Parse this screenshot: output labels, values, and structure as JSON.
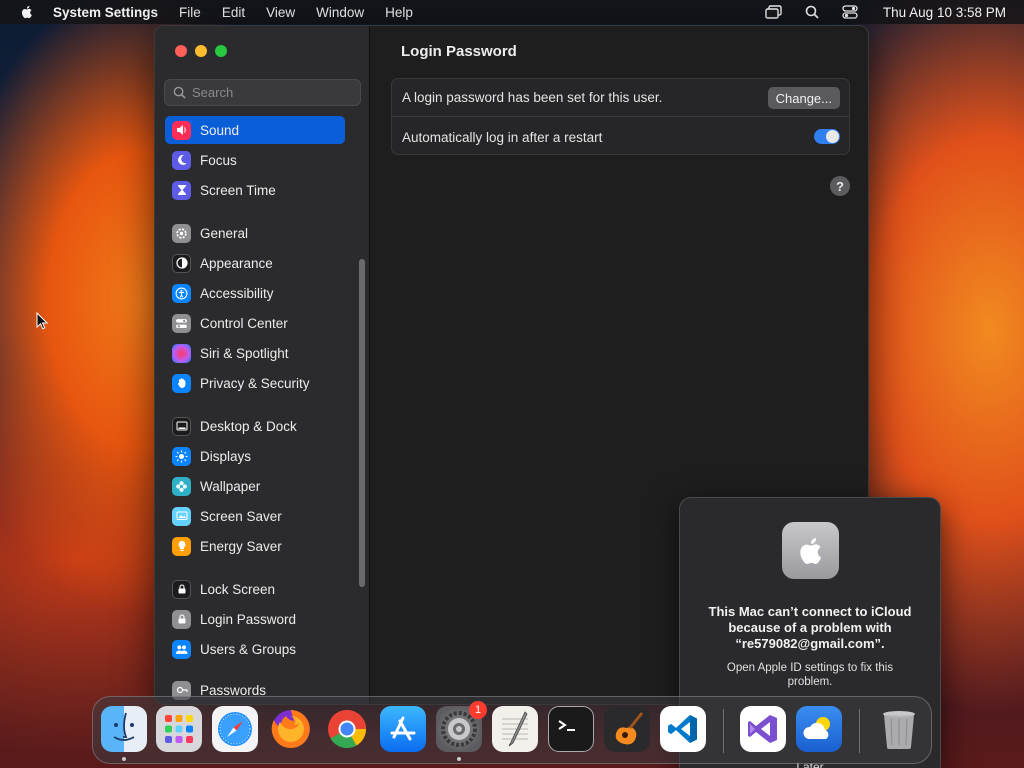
{
  "menubar": {
    "app_name": "System Settings",
    "items": [
      "File",
      "Edit",
      "View",
      "Window",
      "Help"
    ],
    "clock": "Thu Aug 10  3:58 PM"
  },
  "sidebar": {
    "search_placeholder": "Search",
    "items": [
      {
        "label": "Sound",
        "icon": "speaker-icon",
        "color": "#ff2d55"
      },
      {
        "label": "Focus",
        "icon": "moon-icon",
        "color": "#5e5ce6"
      },
      {
        "label": "Screen Time",
        "icon": "hourglass-icon",
        "color": "#5e5ce6"
      },
      {
        "label": "General",
        "icon": "gear-icon",
        "color": "#8e8e93"
      },
      {
        "label": "Appearance",
        "icon": "appearance-icon",
        "color": "#1c1c1e"
      },
      {
        "label": "Accessibility",
        "icon": "accessibility-icon",
        "color": "#0a84ff"
      },
      {
        "label": "Control Center",
        "icon": "toggles-icon",
        "color": "#8e8e93"
      },
      {
        "label": "Siri & Spotlight",
        "icon": "siri-icon",
        "color": "#bf5af2"
      },
      {
        "label": "Privacy & Security",
        "icon": "hand-icon",
        "color": "#0a84ff"
      },
      {
        "label": "Desktop & Dock",
        "icon": "dock-icon",
        "color": "#1c1c1e"
      },
      {
        "label": "Displays",
        "icon": "sun-icon",
        "color": "#0a84ff"
      },
      {
        "label": "Wallpaper",
        "icon": "flower-icon",
        "color": "#30b0c7"
      },
      {
        "label": "Screen Saver",
        "icon": "screensaver-icon",
        "color": "#64d2ff"
      },
      {
        "label": "Energy Saver",
        "icon": "bulb-icon",
        "color": "#ff9f0a"
      },
      {
        "label": "Lock Screen",
        "icon": "lock-icon",
        "color": "#1c1c1e"
      },
      {
        "label": "Login Password",
        "icon": "padlock-icon",
        "color": "#8e8e93"
      },
      {
        "label": "Users & Groups",
        "icon": "users-icon",
        "color": "#0a84ff"
      },
      {
        "label": "Passwords",
        "icon": "key-icon",
        "color": "#8e8e93"
      }
    ],
    "active_index": 0
  },
  "content": {
    "title": "Login Password",
    "row1_text": "A login password has been set for this user.",
    "change_label": "Change...",
    "row2_text": "Automatically log in after a restart",
    "auto_login_enabled": true,
    "help_label": "?"
  },
  "notification": {
    "title": "This Mac can’t connect to iCloud because of a problem with “re579082@gmail.com”.",
    "body": "Open Apple ID settings to fix this problem.",
    "later_label": "Later"
  },
  "dock": {
    "apps": [
      {
        "name": "finder-icon",
        "running": true
      },
      {
        "name": "launchpad-icon",
        "running": false
      },
      {
        "name": "safari-icon",
        "running": false
      },
      {
        "name": "firefox-icon",
        "running": false
      },
      {
        "name": "chrome-icon",
        "running": false
      },
      {
        "name": "app-store-icon",
        "running": false
      },
      {
        "name": "system-settings-icon",
        "running": true,
        "badge": "1"
      },
      {
        "name": "textedit-icon",
        "running": false
      },
      {
        "name": "terminal-icon",
        "running": false
      },
      {
        "name": "garageband-icon",
        "running": false
      },
      {
        "name": "vscode-icon",
        "running": false
      },
      {
        "name": "visual-studio-icon",
        "running": false
      },
      {
        "name": "weather-icon",
        "running": false
      },
      {
        "name": "trash-icon",
        "running": false
      }
    ]
  }
}
